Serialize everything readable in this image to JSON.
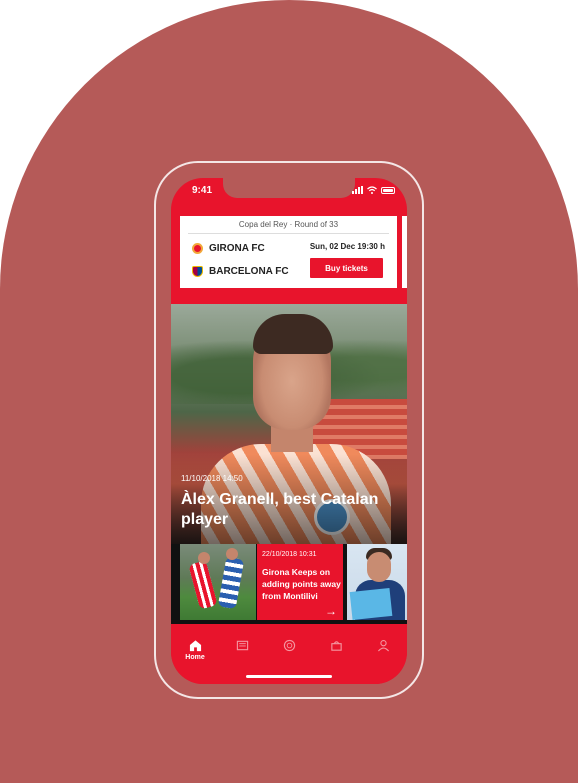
{
  "status_bar": {
    "time": "9:41"
  },
  "match": {
    "competition": "Copa del Rey · Round of 33",
    "home_team": "GIRONA FC",
    "away_team": "BARCELONA FC",
    "date": "Sun, 02 Dec 19:30 h",
    "buy_label": "Buy tickets"
  },
  "hero": {
    "date": "11/10/2018 14:50",
    "title": "Àlex Granell, best Catalan player"
  },
  "news": [
    {
      "date": "22/10/2018 10:31",
      "title": "Girona Keeps on adding points away from Montilivi",
      "arrow": "→"
    }
  ],
  "tabs": [
    {
      "label": "Home",
      "icon": "home-icon",
      "active": true
    },
    {
      "label": "",
      "icon": "news-icon",
      "active": false
    },
    {
      "label": "",
      "icon": "club-crest-icon",
      "active": false
    },
    {
      "label": "",
      "icon": "tickets-icon",
      "active": false
    },
    {
      "label": "",
      "icon": "profile-icon",
      "active": false
    }
  ],
  "colors": {
    "brand_red": "#e8142c",
    "background": "#b55a58"
  }
}
